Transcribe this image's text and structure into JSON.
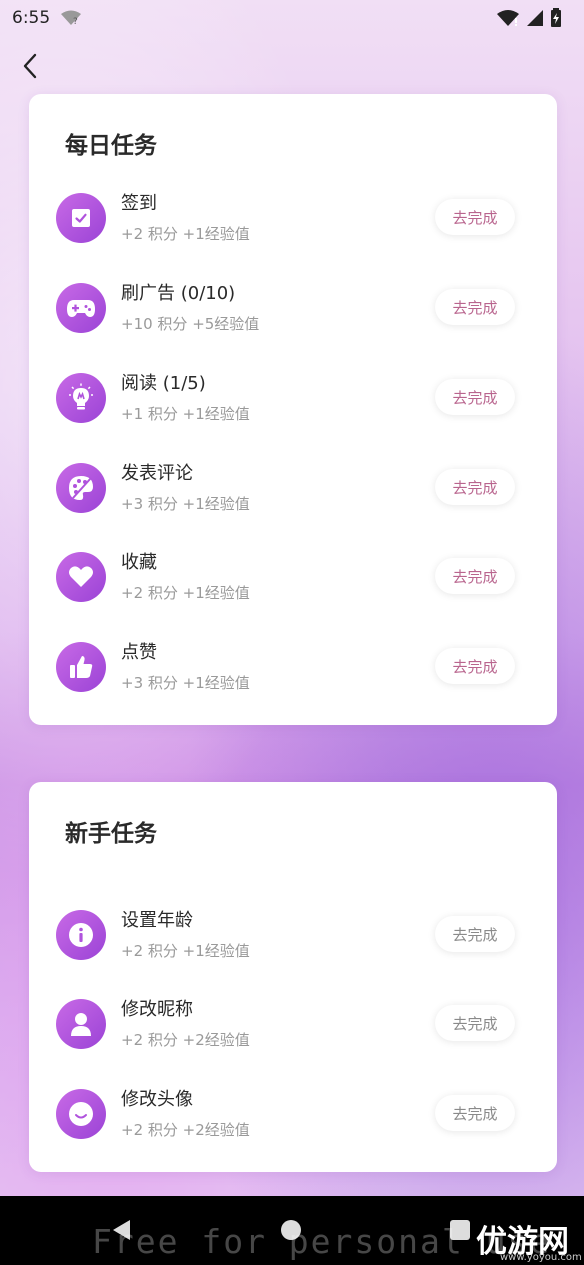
{
  "status_bar": {
    "time": "6:55"
  },
  "daily": {
    "title": "每日任务",
    "tasks": [
      {
        "name": "签到",
        "reward": "+2 积分 +1经验值",
        "button": "去完成",
        "icon": "checkbox-icon"
      },
      {
        "name": "刷广告 (0/10)",
        "reward": "+10 积分 +5经验值",
        "button": "去完成",
        "icon": "gamepad-icon"
      },
      {
        "name": "阅读 (1/5)",
        "reward": "+1 积分 +1经验值",
        "button": "去完成",
        "icon": "lightbulb-icon"
      },
      {
        "name": "发表评论",
        "reward": "+3 积分 +1经验值",
        "button": "去完成",
        "icon": "palette-icon"
      },
      {
        "name": "收藏",
        "reward": "+2 积分 +1经验值",
        "button": "去完成",
        "icon": "heart-icon"
      },
      {
        "name": "点赞",
        "reward": "+3 积分 +1经验值",
        "button": "去完成",
        "icon": "thumbs-up-icon"
      }
    ]
  },
  "newbie": {
    "title": "新手任务",
    "tasks": [
      {
        "name": "设置年龄",
        "reward": "+2 积分 +1经验值",
        "button": "去完成",
        "icon": "info-icon"
      },
      {
        "name": "修改昵称",
        "reward": "+2 积分 +2经验值",
        "button": "去完成",
        "icon": "user-icon"
      },
      {
        "name": "修改头像",
        "reward": "+2 积分 +2经验值",
        "button": "去完成",
        "icon": "smile-icon"
      }
    ]
  },
  "watermark": {
    "text": "Free for personal use",
    "logo": "优游网",
    "url": "www.yoyou.com"
  },
  "colors": {
    "accent_gradient_start": "#c86ae6",
    "accent_gradient_end": "#9b43d6",
    "daily_button_text": "#b9658e",
    "newbie_button_text": "#8a8a8a"
  }
}
